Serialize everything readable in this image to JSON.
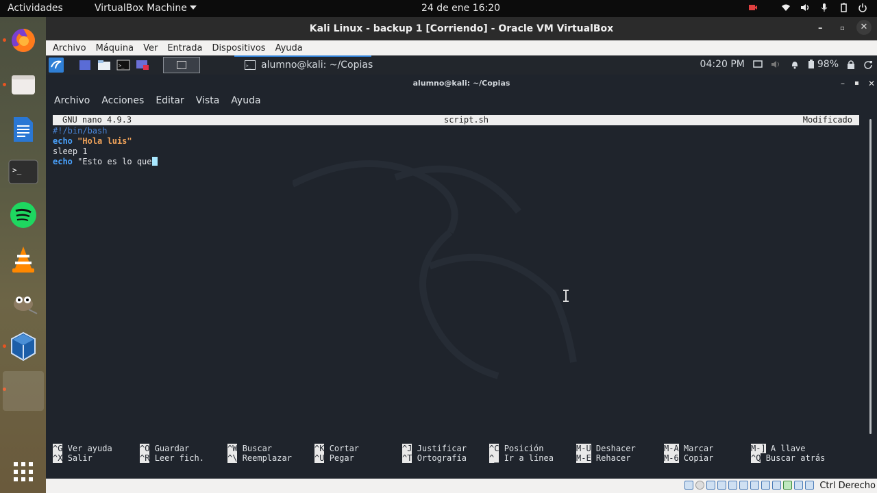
{
  "topbar": {
    "activities": "Actividades",
    "app_menu": "VirtualBox Machine",
    "datetime": "24 de ene  16:20"
  },
  "vbox": {
    "window_title": "Kali Linux - backup 1 [Corriendo] - Oracle VM VirtualBox",
    "menu": [
      "Archivo",
      "Máquina",
      "Ver",
      "Entrada",
      "Dispositivos",
      "Ayuda"
    ],
    "host_key": "Ctrl Derecho"
  },
  "kali_panel": {
    "task_label": "alumno@kali: ~/Copias",
    "time": "04:20 PM",
    "battery": "98%"
  },
  "terminal": {
    "title": "alumno@kali: ~/Copias",
    "menu": [
      "Archivo",
      "Acciones",
      "Editar",
      "Vista",
      "Ayuda"
    ]
  },
  "nano": {
    "version": "GNU nano 4.9.3",
    "filename": "script.sh",
    "status": "Modificado",
    "lines": {
      "l1": "#!/bin/bash",
      "l2_kw": "echo",
      "l2_str": "\"Hola luis\"",
      "l3": "sleep 1",
      "l4_kw": "echo",
      "l4_text": "\"Esto es lo que"
    },
    "shortcuts": [
      {
        "k1": "^G",
        "l1": "Ver ayuda",
        "k2": "^X",
        "l2": "Salir"
      },
      {
        "k1": "^O",
        "l1": "Guardar",
        "k2": "^R",
        "l2": "Leer fich."
      },
      {
        "k1": "^W",
        "l1": "Buscar",
        "k2": "^\\",
        "l2": "Reemplazar"
      },
      {
        "k1": "^K",
        "l1": "Cortar",
        "k2": "^U",
        "l2": "Pegar"
      },
      {
        "k1": "^J",
        "l1": "Justificar",
        "k2": "^T",
        "l2": "Ortografía"
      },
      {
        "k1": "^C",
        "l1": "Posición",
        "k2": "^_",
        "l2": "Ir a línea"
      },
      {
        "k1": "M-U",
        "l1": "Deshacer",
        "k2": "M-E",
        "l2": "Rehacer"
      },
      {
        "k1": "M-A",
        "l1": "Marcar",
        "k2": "M-6",
        "l2": "Copiar"
      },
      {
        "k1": "M-]",
        "l1": "A llave",
        "k2": "^Q",
        "l2": "Buscar atrás"
      }
    ]
  },
  "dock_icons": [
    "firefox-icon",
    "files-icon",
    "libreoffice-writer-icon",
    "terminal-icon",
    "spotify-icon",
    "vlc-icon",
    "gimp-icon",
    "virtualbox-icon",
    "virtualbox-machine-icon",
    "show-applications-icon"
  ]
}
